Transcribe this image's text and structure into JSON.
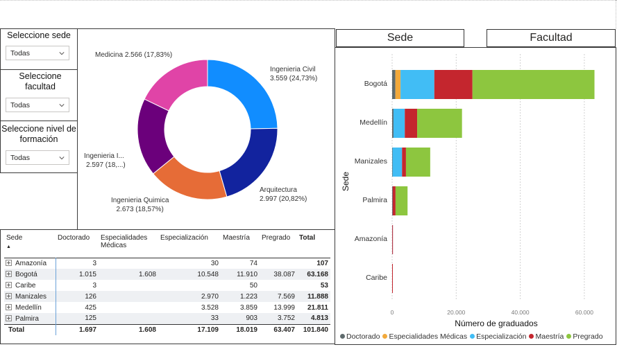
{
  "slicers": [
    {
      "title": "Seleccione sede",
      "value": "Todas"
    },
    {
      "title": "Seleccione facultad",
      "value": "Todas"
    },
    {
      "title": "Seleccione nivel de formación",
      "value": "Todas"
    }
  ],
  "donut": {
    "type": "donut",
    "slices": [
      {
        "name": "Ingenieria Civil",
        "value": "3.559 (24,73%)",
        "num": 3559,
        "color": "#118dff"
      },
      {
        "name": "Arquitectura",
        "value": "2.997 (20,82%)",
        "num": 2997,
        "color": "#12239e"
      },
      {
        "name": "Ingenieria Quimica",
        "value": "2.673 (18,57%)",
        "num": 2673,
        "color": "#e66c37"
      },
      {
        "name": "Ingenieria I...",
        "value": "2.597 (18,...)",
        "num": 2597,
        "color": "#6b007b"
      },
      {
        "name": "Medicina",
        "value": "2.566 (17,83%)",
        "num": 2566,
        "color": "#e044a7"
      }
    ]
  },
  "buttons": {
    "sede": "Sede",
    "facultad": "Facultad"
  },
  "matrix": {
    "headers": [
      "Sede",
      "Doctorado",
      "Especialidades Médicas",
      "Especialización",
      "Maestría",
      "Pregrado",
      "Total"
    ],
    "rows": [
      {
        "sede": "Amazonía",
        "doc": "3",
        "esm": "",
        "esp": "30",
        "mae": "74",
        "pre": "",
        "tot": "107"
      },
      {
        "sede": "Bogotá",
        "doc": "1.015",
        "esm": "1.608",
        "esp": "10.548",
        "mae": "11.910",
        "pre": "38.087",
        "tot": "63.168"
      },
      {
        "sede": "Caribe",
        "doc": "3",
        "esm": "",
        "esp": "",
        "mae": "50",
        "pre": "",
        "tot": "53"
      },
      {
        "sede": "Manizales",
        "doc": "126",
        "esm": "",
        "esp": "2.970",
        "mae": "1.223",
        "pre": "7.569",
        "tot": "11.888"
      },
      {
        "sede": "Medellín",
        "doc": "425",
        "esm": "",
        "esp": "3.528",
        "mae": "3.859",
        "pre": "13.999",
        "tot": "21.811"
      },
      {
        "sede": "Palmira",
        "doc": "125",
        "esm": "",
        "esp": "33",
        "mae": "903",
        "pre": "3.752",
        "tot": "4.813"
      }
    ],
    "total": {
      "sede": "Total",
      "doc": "1.697",
      "esm": "1.608",
      "esp": "17.109",
      "mae": "18.019",
      "pre": "63.407",
      "tot": "101.840"
    }
  },
  "chart_data": {
    "type": "bar",
    "orientation": "horizontal-stacked",
    "categories": [
      "Bogotá",
      "Medellín",
      "Manizales",
      "Palmira",
      "Amazonía",
      "Caribe"
    ],
    "series": [
      {
        "name": "Doctorado",
        "color": "#5f6b6d",
        "values": [
          1015,
          425,
          126,
          125,
          3,
          3
        ]
      },
      {
        "name": "Especialidades Médicas",
        "color": "#f2a93b",
        "values": [
          1608,
          0,
          0,
          0,
          0,
          0
        ]
      },
      {
        "name": "Especialización",
        "color": "#41bdf5",
        "values": [
          10548,
          3528,
          2970,
          33,
          30,
          0
        ]
      },
      {
        "name": "Maestría",
        "color": "#c4262e",
        "values": [
          11910,
          3859,
          1223,
          903,
          74,
          50
        ]
      },
      {
        "name": "Pregrado",
        "color": "#8dc63f",
        "values": [
          38087,
          13999,
          7569,
          3752,
          0,
          0
        ]
      }
    ],
    "xlim": [
      0,
      65000
    ],
    "xticks": [
      "0",
      "20.000",
      "40.000",
      "60.000"
    ],
    "xlabel": "Número de graduados",
    "ylabel": "Sede",
    "grid": true,
    "legend": "bottom"
  }
}
